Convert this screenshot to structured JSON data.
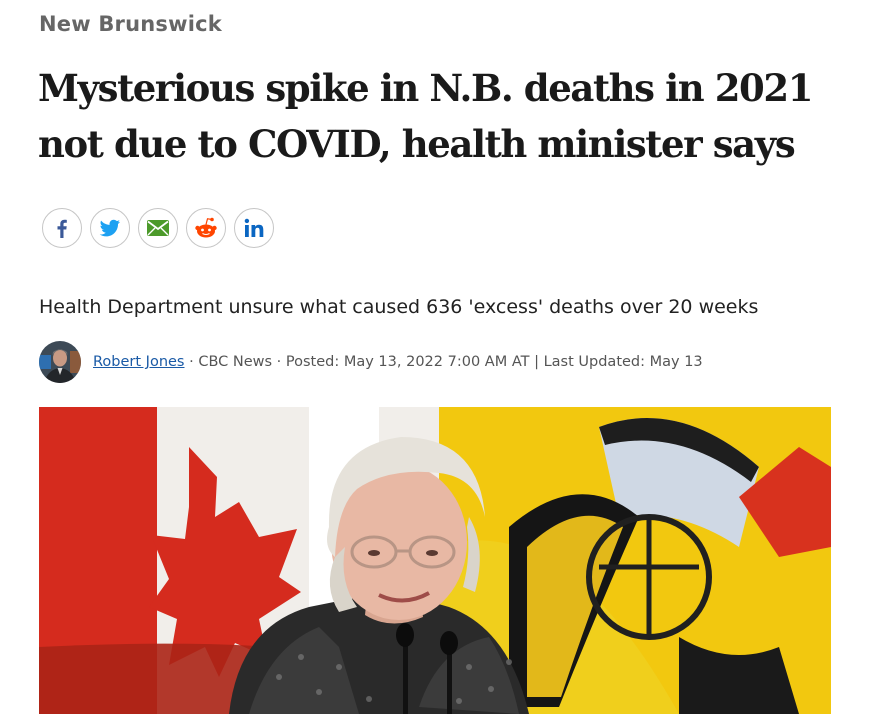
{
  "article": {
    "section": "New Brunswick",
    "headline_line1": "Mysterious spike in N.B. deaths in 2021",
    "headline_line2": "not due to COVID, health minister says",
    "deck": "Health Department unsure what caused 636 'excess' deaths over 20 weeks"
  },
  "share": [
    {
      "icon": "facebook-icon",
      "color": "#3b5998"
    },
    {
      "icon": "twitter-icon",
      "color": "#1da1f2"
    },
    {
      "icon": "email-icon",
      "color": "#4c9a2a"
    },
    {
      "icon": "reddit-icon",
      "color": "#ff4500"
    },
    {
      "icon": "linkedin-icon",
      "color": "#0a66c2"
    }
  ],
  "byline": {
    "author": "Robert Jones",
    "sep1": " · ",
    "outlet": "CBC News",
    "sep2": " · ",
    "posted": "Posted: May 13, 2022 7:00 AM AT",
    "sep3": " | ",
    "updated": "Last Updated: May 13"
  },
  "colors": {
    "section_text": "#666666",
    "author_link": "#1a5aa6",
    "flag_red": "#d52b1e",
    "nb_yellow": "#f2c80f"
  }
}
